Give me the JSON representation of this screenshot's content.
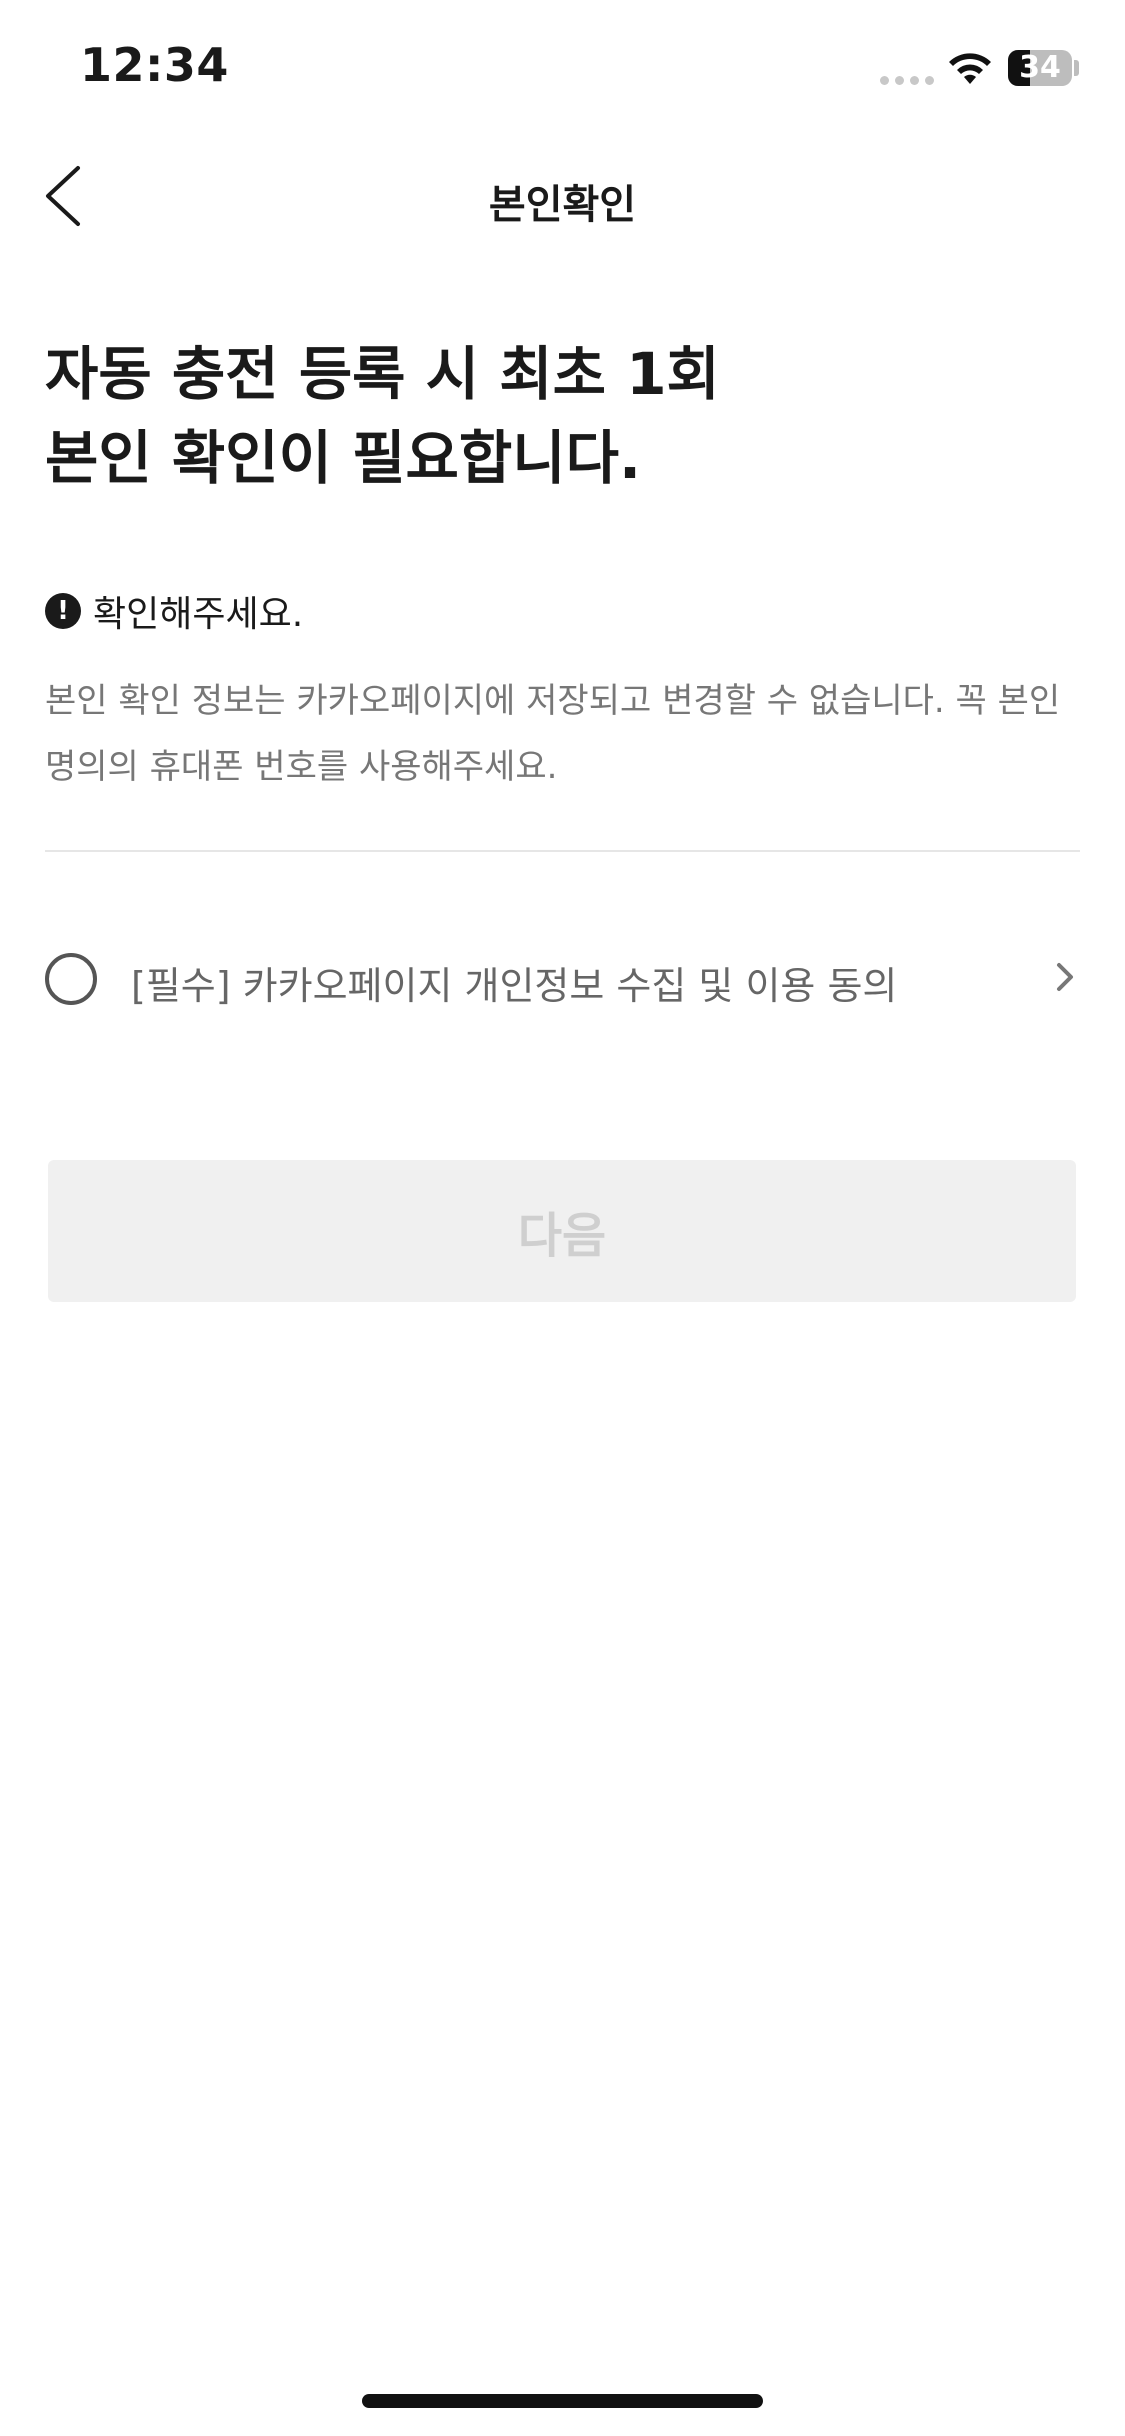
{
  "status_bar": {
    "time": "12:34",
    "battery_level": "34",
    "battery_fraction": 0.34,
    "icons": [
      "signal-dots-icon",
      "wifi-icon",
      "battery-icon"
    ]
  },
  "nav": {
    "title": "본인확인",
    "back_icon": "chevron-left-icon"
  },
  "headline": {
    "line1": "자동 충전 등록 시 최초 1회",
    "line2": "본인 확인이 필요합니다."
  },
  "notice": {
    "icon": "exclamation-circle-icon",
    "title": "확인해주세요.",
    "description": "본인 확인 정보는 카카오페이지에 저장되고 변경할 수 없습니다. 꼭 본인 명의의 휴대폰 번호를 사용해주세요."
  },
  "agreement": {
    "label": "[필수] 카카오페이지 개인정보 수집 및 이용 동의",
    "checked": false,
    "chevron_icon": "chevron-right-icon"
  },
  "next_button": {
    "label": "다음",
    "enabled": false
  },
  "colors": {
    "text_primary": "#1a1a1a",
    "text_secondary": "#777777",
    "button_disabled_bg": "#f0f0f0",
    "button_disabled_text": "#cfcfcf",
    "divider": "#e6e6e6"
  }
}
